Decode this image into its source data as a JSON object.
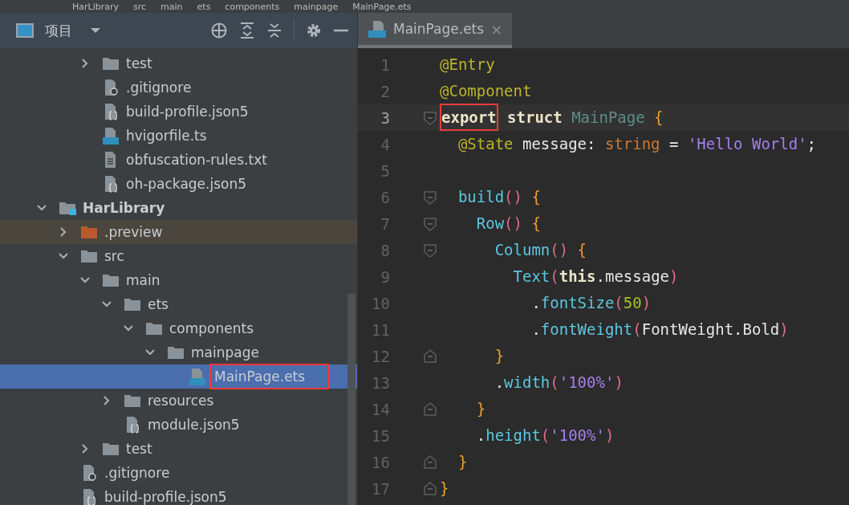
{
  "breadcrumb": [
    "HarLibrary",
    "src",
    "main",
    "ets",
    "components",
    "mainpage",
    "MainPage.ets"
  ],
  "project_panel": {
    "title": "项目"
  },
  "tree": [
    {
      "children": [
        {
          "children": [
            {
              "label": "test",
              "kind": "folder",
              "expanded": false,
              "selected": false
            },
            {
              "label": ".gitignore",
              "kind": "ignore",
              "selected": false
            },
            {
              "label": "build-profile.json5",
              "kind": "json",
              "selected": false
            },
            {
              "label": "hvigorfile.ts",
              "kind": "ts",
              "selected": false
            },
            {
              "label": "obfuscation-rules.txt",
              "kind": "txt",
              "selected": false
            },
            {
              "label": "oh-package.json5",
              "kind": "json",
              "selected": false
            }
          ]
        }
      ]
    },
    {
      "label": "HarLibrary",
      "kind": "module",
      "expanded": true,
      "selected": false,
      "children": [
        {
          "label": ".preview",
          "kind": "excluded",
          "expanded": false,
          "selected": false
        },
        {
          "label": "src",
          "kind": "folder",
          "expanded": true,
          "selected": false,
          "children": [
            {
              "label": "main",
              "kind": "folder",
              "expanded": true,
              "selected": false,
              "children": [
                {
                  "label": "ets",
                  "kind": "folder",
                  "expanded": true,
                  "selected": false,
                  "children": [
                    {
                      "label": "components",
                      "kind": "folder",
                      "expanded": true,
                      "selected": false,
                      "children": [
                        {
                          "label": "mainpage",
                          "kind": "folder",
                          "expanded": true,
                          "selected": false,
                          "children": [
                            {
                              "label": "MainPage.ets",
                              "kind": "ets",
                              "selected": true,
                              "boxed": true
                            }
                          ]
                        }
                      ]
                    }
                  ]
                },
                {
                  "label": "resources",
                  "kind": "folder",
                  "expanded": false,
                  "selected": false
                },
                {
                  "label": "module.json5",
                  "kind": "json",
                  "selected": false
                }
              ]
            },
            {
              "label": "test",
              "kind": "folder",
              "expanded": false,
              "selected": false
            }
          ]
        },
        {
          "label": ".gitignore",
          "kind": "ignore",
          "selected": false
        },
        {
          "label": "build-profile.json5",
          "kind": "json",
          "selected": false
        }
      ]
    }
  ],
  "tabs": [
    {
      "label": "MainPage.ets",
      "close": "×",
      "selected": true
    }
  ],
  "code": [
    {
      "number": "1",
      "tokens": [
        {
          "text": "@Entry",
          "kind": "deco"
        }
      ]
    },
    {
      "number": "2",
      "tokens": [
        {
          "text": "@Component",
          "kind": "deco"
        }
      ]
    },
    {
      "number": "3",
      "current": true,
      "fold_start": true,
      "tokens": [
        {
          "text": "export",
          "kind": "kw",
          "boxed": true
        },
        {
          "text": " struct",
          "kind": "kw"
        },
        {
          "text": " MainPage",
          "kind": "cls"
        },
        {
          "text": " {",
          "kind": "brace"
        }
      ]
    },
    {
      "number": "4",
      "tokens": [
        {
          "text": "  @State",
          "kind": "deco"
        },
        {
          "text": " message:",
          "kind": "plain"
        },
        {
          "text": " string",
          "kind": "type"
        },
        {
          "text": " =",
          "kind": "plain"
        },
        {
          "text": " 'Hello World'",
          "kind": "str"
        },
        {
          "text": ";",
          "kind": "plain"
        }
      ]
    },
    {
      "number": "5"
    },
    {
      "number": "6",
      "fold_start": true,
      "tokens": [
        {
          "text": "  build",
          "kind": "fn"
        },
        {
          "text": "()",
          "kind": "paren"
        },
        {
          "text": " {",
          "kind": "brace"
        }
      ]
    },
    {
      "number": "7",
      "fold_start": true,
      "tokens": [
        {
          "text": "    Row",
          "kind": "fn"
        },
        {
          "text": "()",
          "kind": "paren"
        },
        {
          "text": " {",
          "kind": "brace"
        }
      ]
    },
    {
      "number": "8",
      "fold_start": true,
      "tokens": [
        {
          "text": "      Column",
          "kind": "fn"
        },
        {
          "text": "()",
          "kind": "paren"
        },
        {
          "text": " {",
          "kind": "brace"
        }
      ]
    },
    {
      "number": "9",
      "tokens": [
        {
          "text": "        Text",
          "kind": "fn"
        },
        {
          "text": "(",
          "kind": "paren"
        },
        {
          "text": "this",
          "kind": "kw"
        },
        {
          "text": ".message",
          "kind": "plain"
        },
        {
          "text": ")",
          "kind": "paren"
        }
      ]
    },
    {
      "number": "10",
      "tokens": [
        {
          "text": "          .",
          "kind": "plain"
        },
        {
          "text": "fontSize",
          "kind": "fn"
        },
        {
          "text": "(",
          "kind": "paren"
        },
        {
          "text": "50",
          "kind": "num"
        },
        {
          "text": ")",
          "kind": "paren"
        }
      ]
    },
    {
      "number": "11",
      "tokens": [
        {
          "text": "          .",
          "kind": "plain"
        },
        {
          "text": "fontWeight",
          "kind": "fn"
        },
        {
          "text": "(",
          "kind": "paren"
        },
        {
          "text": "FontWeight.Bold",
          "kind": "plain"
        },
        {
          "text": ")",
          "kind": "paren"
        }
      ]
    },
    {
      "number": "12",
      "fold_end": true,
      "tokens": [
        {
          "text": "      }",
          "kind": "brace"
        }
      ]
    },
    {
      "number": "13",
      "tokens": [
        {
          "text": "      .",
          "kind": "plain"
        },
        {
          "text": "width",
          "kind": "fn"
        },
        {
          "text": "(",
          "kind": "paren"
        },
        {
          "text": "'100%'",
          "kind": "str"
        },
        {
          "text": ")",
          "kind": "paren"
        }
      ]
    },
    {
      "number": "14",
      "fold_end": true,
      "tokens": [
        {
          "text": "    }",
          "kind": "brace"
        }
      ]
    },
    {
      "number": "15",
      "tokens": [
        {
          "text": "    .",
          "kind": "plain"
        },
        {
          "text": "height",
          "kind": "fn"
        },
        {
          "text": "(",
          "kind": "paren"
        },
        {
          "text": "'100%'",
          "kind": "str"
        },
        {
          "text": ")",
          "kind": "paren"
        }
      ]
    },
    {
      "number": "16",
      "fold_end": true,
      "tokens": [
        {
          "text": "  }",
          "kind": "brace"
        }
      ]
    },
    {
      "number": "17",
      "fold_end": true,
      "tokens": [
        {
          "text": "}",
          "kind": "brace"
        }
      ]
    }
  ]
}
